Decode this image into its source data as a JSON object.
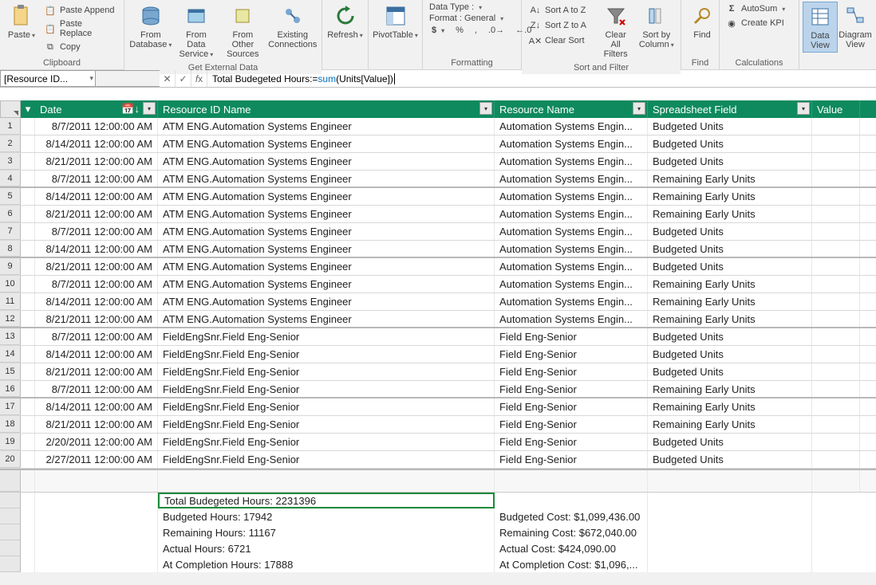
{
  "ribbon": {
    "clipboard": {
      "paste": "Paste",
      "paste_append": "Paste Append",
      "paste_replace": "Paste Replace",
      "copy": "Copy",
      "group": "Clipboard"
    },
    "external": {
      "from_db": "From\nDatabase",
      "from_ds": "From Data\nService",
      "from_other": "From Other\nSources",
      "existing": "Existing\nConnections",
      "group": "Get External Data"
    },
    "refresh": "Refresh",
    "pivot": "PivotTable",
    "formatting": {
      "data_type": "Data Type :",
      "format_lbl": "Format : General",
      "group": "Formatting"
    },
    "sort": {
      "az": "Sort A to Z",
      "za": "Sort Z to A",
      "clear": "Clear Sort",
      "clear_filters": "Clear All\nFilters",
      "sort_by": "Sort by\nColumn",
      "group": "Sort and Filter"
    },
    "find": {
      "btn": "Find",
      "group": "Find"
    },
    "calc": {
      "autosum": "AutoSum",
      "kpi": "Create KPI",
      "group": "Calculations"
    },
    "view": {
      "data": "Data\nView",
      "diagram": "Diagram\nView"
    }
  },
  "formula": {
    "namebox": "[Resource ID...",
    "text_pre": "Total Budegeted Hours:=",
    "fn": "sum",
    "text_post": "(Units[Value])"
  },
  "columns": {
    "date": "Date",
    "resid": "Resource ID Name",
    "resname": "Resource Name",
    "field": "Spreadsheet Field",
    "value": "Value"
  },
  "rows": [
    {
      "n": 1,
      "date": "8/7/2011 12:00:00 AM",
      "resid": "ATM ENG.Automation Systems Engineer",
      "resname": "Automation Systems Engin...",
      "field": "Budgeted Units",
      "sep": false
    },
    {
      "n": 2,
      "date": "8/14/2011 12:00:00 AM",
      "resid": "ATM ENG.Automation Systems Engineer",
      "resname": "Automation Systems Engin...",
      "field": "Budgeted Units",
      "sep": false
    },
    {
      "n": 3,
      "date": "8/21/2011 12:00:00 AM",
      "resid": "ATM ENG.Automation Systems Engineer",
      "resname": "Automation Systems Engin...",
      "field": "Budgeted Units",
      "sep": false
    },
    {
      "n": 4,
      "date": "8/7/2011 12:00:00 AM",
      "resid": "ATM ENG.Automation Systems Engineer",
      "resname": "Automation Systems Engin...",
      "field": "Remaining Early Units",
      "sep": true
    },
    {
      "n": 5,
      "date": "8/14/2011 12:00:00 AM",
      "resid": "ATM ENG.Automation Systems Engineer",
      "resname": "Automation Systems Engin...",
      "field": "Remaining Early Units",
      "sep": false
    },
    {
      "n": 6,
      "date": "8/21/2011 12:00:00 AM",
      "resid": "ATM ENG.Automation Systems Engineer",
      "resname": "Automation Systems Engin...",
      "field": "Remaining Early Units",
      "sep": false
    },
    {
      "n": 7,
      "date": "8/7/2011 12:00:00 AM",
      "resid": "ATM ENG.Automation Systems Engineer",
      "resname": "Automation Systems Engin...",
      "field": "Budgeted Units",
      "sep": false
    },
    {
      "n": 8,
      "date": "8/14/2011 12:00:00 AM",
      "resid": "ATM ENG.Automation Systems Engineer",
      "resname": "Automation Systems Engin...",
      "field": "Budgeted Units",
      "sep": true
    },
    {
      "n": 9,
      "date": "8/21/2011 12:00:00 AM",
      "resid": "ATM ENG.Automation Systems Engineer",
      "resname": "Automation Systems Engin...",
      "field": "Budgeted Units",
      "sep": false
    },
    {
      "n": 10,
      "date": "8/7/2011 12:00:00 AM",
      "resid": "ATM ENG.Automation Systems Engineer",
      "resname": "Automation Systems Engin...",
      "field": "Remaining Early Units",
      "sep": false
    },
    {
      "n": 11,
      "date": "8/14/2011 12:00:00 AM",
      "resid": "ATM ENG.Automation Systems Engineer",
      "resname": "Automation Systems Engin...",
      "field": "Remaining Early Units",
      "sep": false
    },
    {
      "n": 12,
      "date": "8/21/2011 12:00:00 AM",
      "resid": "ATM ENG.Automation Systems Engineer",
      "resname": "Automation Systems Engin...",
      "field": "Remaining Early Units",
      "sep": true
    },
    {
      "n": 13,
      "date": "8/7/2011 12:00:00 AM",
      "resid": "FieldEngSnr.Field Eng-Senior",
      "resname": "Field Eng-Senior",
      "field": "Budgeted Units",
      "sep": false
    },
    {
      "n": 14,
      "date": "8/14/2011 12:00:00 AM",
      "resid": "FieldEngSnr.Field Eng-Senior",
      "resname": "Field Eng-Senior",
      "field": "Budgeted Units",
      "sep": false
    },
    {
      "n": 15,
      "date": "8/21/2011 12:00:00 AM",
      "resid": "FieldEngSnr.Field Eng-Senior",
      "resname": "Field Eng-Senior",
      "field": "Budgeted Units",
      "sep": false
    },
    {
      "n": 16,
      "date": "8/7/2011 12:00:00 AM",
      "resid": "FieldEngSnr.Field Eng-Senior",
      "resname": "Field Eng-Senior",
      "field": "Remaining Early Units",
      "sep": true
    },
    {
      "n": 17,
      "date": "8/14/2011 12:00:00 AM",
      "resid": "FieldEngSnr.Field Eng-Senior",
      "resname": "Field Eng-Senior",
      "field": "Remaining Early Units",
      "sep": false
    },
    {
      "n": 18,
      "date": "8/21/2011 12:00:00 AM",
      "resid": "FieldEngSnr.Field Eng-Senior",
      "resname": "Field Eng-Senior",
      "field": "Remaining Early Units",
      "sep": false
    },
    {
      "n": 19,
      "date": "2/20/2011 12:00:00 AM",
      "resid": "FieldEngSnr.Field Eng-Senior",
      "resname": "Field Eng-Senior",
      "field": "Budgeted Units",
      "sep": false
    },
    {
      "n": 20,
      "date": "2/27/2011 12:00:00 AM",
      "resid": "FieldEngSnr.Field Eng-Senior",
      "resname": "Field Eng-Senior",
      "field": "Budgeted Units",
      "sep": false
    }
  ],
  "summary": {
    "total": "Total Budegeted Hours: 2231396",
    "left": [
      "Budgeted Hours: 17942",
      "Remaining Hours: 11167",
      "Actual Hours: 6721",
      "At Completion Hours: 17888"
    ],
    "right": [
      "Budgeted Cost: $1,099,436.00",
      "Remaining Cost: $672,040.00",
      "Actual Cost: $424,090.00",
      "At Completion Cost: $1,096,..."
    ]
  }
}
